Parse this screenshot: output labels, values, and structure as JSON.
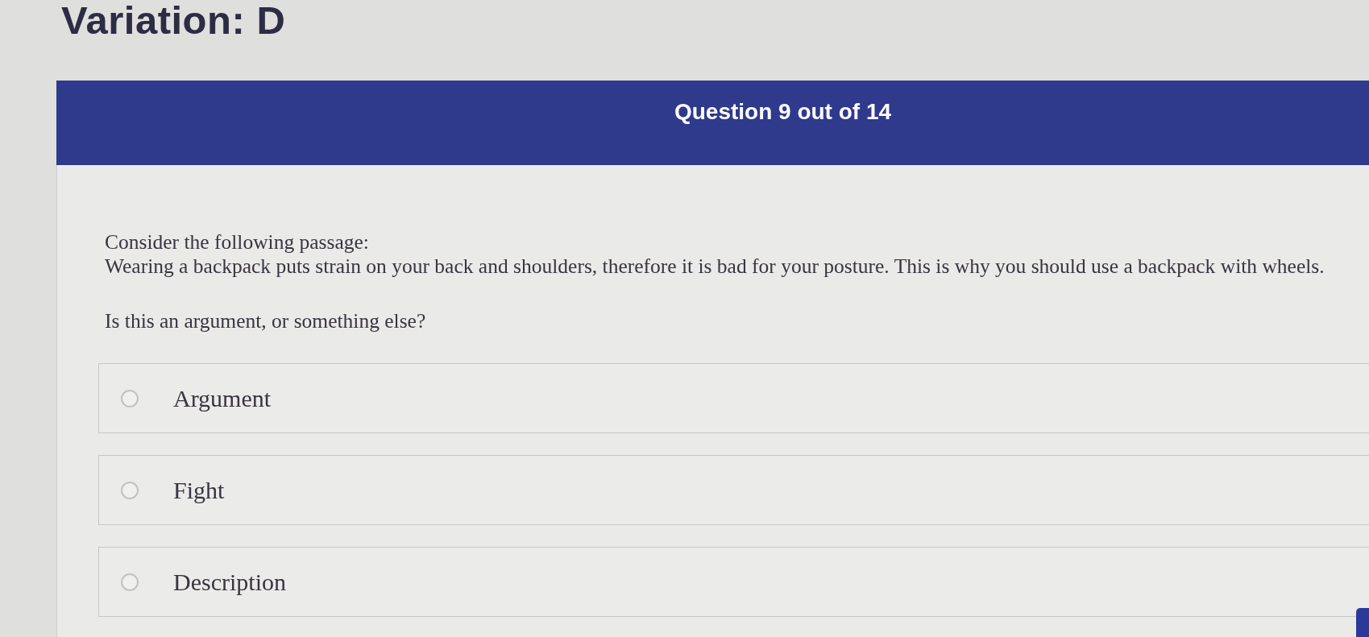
{
  "page": {
    "title": "Variation: D"
  },
  "question": {
    "header": "Question 9 out of 14",
    "intro": "Consider the following passage:",
    "passage": "Wearing a backpack puts strain on your back and shoulders, therefore it is bad for your posture. This is why you should use a backpack with wheels.",
    "prompt": "Is this an argument, or something else?"
  },
  "options": [
    {
      "label": "Argument",
      "selected": false
    },
    {
      "label": "Fight",
      "selected": false
    },
    {
      "label": "Description",
      "selected": false
    }
  ]
}
